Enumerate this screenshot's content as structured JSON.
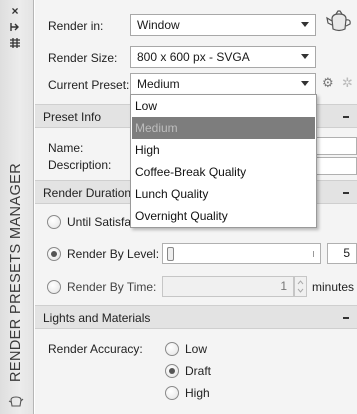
{
  "palette_title": "RENDER PRESETS MANAGER",
  "strip_icons": [
    "close-icon",
    "auto-hide-icon",
    "properties-icon"
  ],
  "render_in": {
    "label": "Render in:",
    "value": "Window"
  },
  "render_size": {
    "label": "Render Size:",
    "value": "800 x 600 px - SVGA"
  },
  "current_preset": {
    "label": "Current Preset:",
    "value": "Medium"
  },
  "preset_options": [
    "Low",
    "Medium",
    "High",
    "Coffee-Break Quality",
    "Lunch Quality",
    "Overnight Quality"
  ],
  "preset_selected_index": 1,
  "preset_info": {
    "title": "Preset Info",
    "name_label": "Name:",
    "description_label": "Description:"
  },
  "render_duration": {
    "title": "Render Duration",
    "until_satisfactory": "Until Satisfa",
    "by_level": {
      "label": "Render By Level:",
      "value": "5"
    },
    "by_time": {
      "label": "Render By Time:",
      "value": "1",
      "unit": "minutes"
    },
    "selected": "by_level"
  },
  "lights_materials": {
    "title": "Lights and Materials",
    "accuracy_label": "Render Accuracy:",
    "options": [
      "Low",
      "Draft",
      "High"
    ],
    "selected": "Draft"
  },
  "colors": {
    "highlight": "#7d7d7d",
    "section_bg": "#e3e3e3"
  }
}
